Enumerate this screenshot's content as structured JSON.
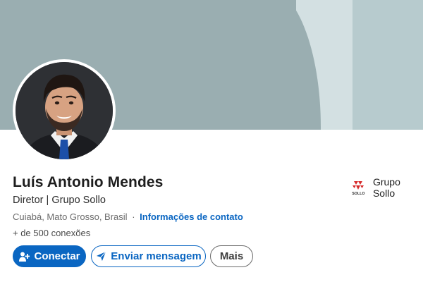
{
  "profile": {
    "name": "Luís Antonio Mendes",
    "headline": "Diretor | Grupo Sollo",
    "location": "Cuiabá, Mato Grosso, Brasil",
    "separator": "·",
    "contact_link": "Informações de contato",
    "connections": "+ de 500 conexões"
  },
  "actions": {
    "connect_label": "Conectar",
    "message_label": "Enviar mensagem",
    "more_label": "Mais"
  },
  "company": {
    "name": "Grupo Sollo",
    "logo_text": "SOLLO"
  },
  "icons": {
    "connect": "add-person-icon",
    "message": "send-icon",
    "company": "sollo-logo-icon"
  },
  "colors": {
    "primary": "#0a66c2",
    "banner": "#9aaeb1",
    "logo_red": "#d62b2b"
  }
}
